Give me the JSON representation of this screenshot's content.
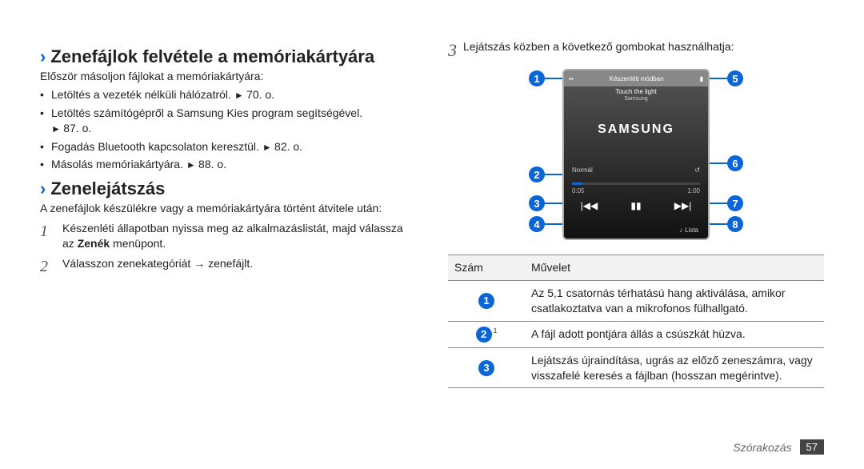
{
  "left": {
    "heading1": "Zenefájlok felvétele a memóriakártyára",
    "intro1": "Először másoljon fájlokat a memóriakártyára:",
    "bullets": [
      {
        "text": "Letöltés a vezeték nélküli hálózatról.",
        "ref": "70. o."
      },
      {
        "text": "Letöltés számítógépről a Samsung Kies program segítségével.",
        "ref": "87. o."
      },
      {
        "text": "Fogadás Bluetooth kapcsolaton keresztül.",
        "ref": "82. o."
      },
      {
        "text": "Másolás memóriakártyára.",
        "ref": "88. o."
      }
    ],
    "heading2": "Zenelejátszás",
    "intro2": "A zenefájlok készülékre vagy a memóriakártyára történt átvitele után:",
    "steps": [
      {
        "num": "1",
        "text_before": "Készenléti állapotban nyissa meg az alkalmazáslistát, majd válassza az ",
        "bold": "Zenék",
        "text_after": " menüpont."
      },
      {
        "num": "2",
        "text_before": "Válasszon zenekategóriát → zenefájlt.",
        "bold": "",
        "text_after": ""
      }
    ]
  },
  "right": {
    "step_num": "3",
    "step_text": "Lejátszás közben a következő gombokat használhatja:",
    "player": {
      "topbar": "Készenléti módban",
      "track_title": "Touch the light",
      "track_artist": "Samsung",
      "logo": "SAMSUNG",
      "mode": "Normál",
      "elapsed": "0:05",
      "total": "1:00",
      "list_label": "Lista"
    },
    "callouts_left": [
      "1",
      "2",
      "3",
      "4"
    ],
    "callouts_right": [
      "5",
      "6",
      "7",
      "8"
    ],
    "table": {
      "head_num": "Szám",
      "head_op": "Művelet",
      "rows": [
        {
          "num": "1",
          "foot": "",
          "op": "Az 5,1 csatornás térhatású hang aktiválása, amikor csatlakoztatva van a mikrofonos fülhallgató."
        },
        {
          "num": "2",
          "foot": "1",
          "op": "A fájl adott pontjára állás a csúszkát húzva."
        },
        {
          "num": "3",
          "foot": "",
          "op": "Lejátszás újraindítása, ugrás az előző zeneszámra, vagy visszafelé keresés a fájlban (hosszan megérintve)."
        }
      ]
    }
  },
  "footer": {
    "section": "Szórakozás",
    "page": "57"
  }
}
